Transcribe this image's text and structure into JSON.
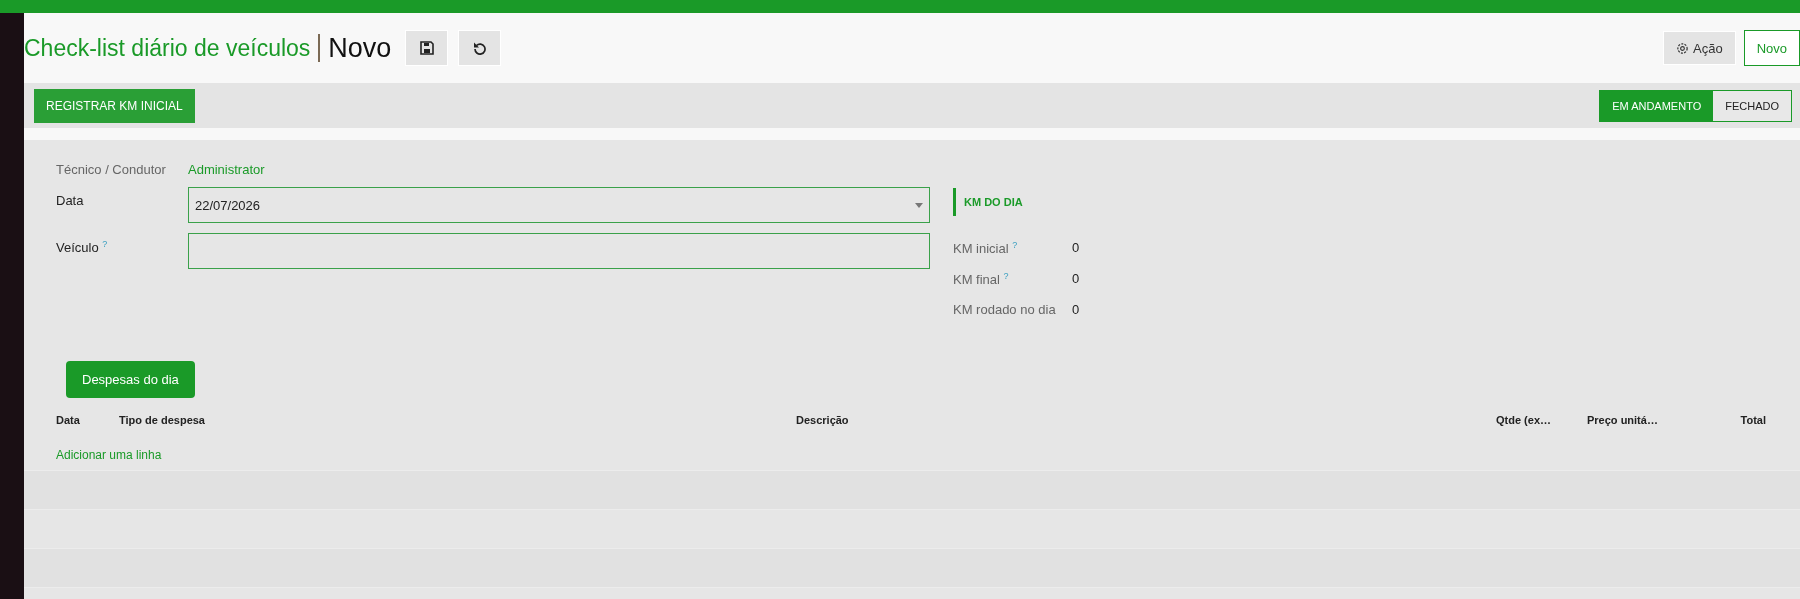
{
  "breadcrumb": {
    "parent": "Check-list diário de veículos",
    "current": "Novo"
  },
  "header_actions": {
    "action": "Ação",
    "new": "Novo"
  },
  "toolbar": {
    "button": "REGISTRAR KM INICIAL"
  },
  "status": [
    {
      "label": "EM ANDAMENTO",
      "selected": true
    },
    {
      "label": "FECHADO",
      "selected": false
    }
  ],
  "form": {
    "technician_label": "Técnico / Condutor",
    "technician_value": "Administrator",
    "fields": [
      {
        "label": "Data",
        "kind": "dropdown",
        "value": "22/07/2026"
      },
      {
        "label": "Veículo",
        "help": "?",
        "kind": "text"
      }
    ]
  },
  "km_section": {
    "title": "KM DO DIA",
    "rows": [
      {
        "label": "KM inicial",
        "help": "?",
        "value": "0"
      },
      {
        "label": "KM final",
        "help": "?",
        "value": "0"
      },
      {
        "label": "KM rodado no dia",
        "value": "0"
      }
    ]
  },
  "expenses": {
    "button": "Despesas do dia",
    "columns": [
      "Data",
      "Tipo de despesa",
      "Descrição",
      "Qtde (ex…",
      "Preço unitá…",
      "Total"
    ],
    "add_line": "Adicionar uma linha"
  }
}
